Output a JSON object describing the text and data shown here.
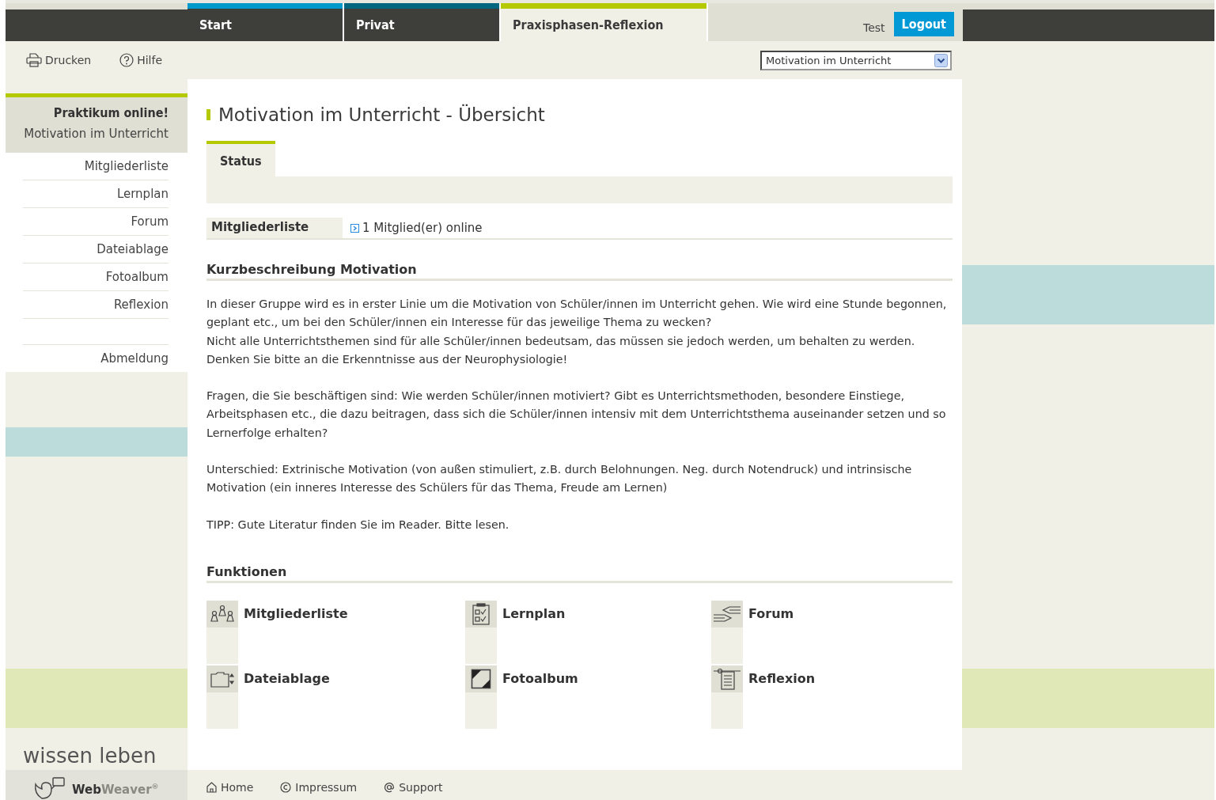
{
  "header": {
    "tabs": [
      {
        "label": "Start",
        "selected": false,
        "color": "#0099cc"
      },
      {
        "label": "Privat",
        "selected": false,
        "color": "#006680"
      },
      {
        "label": "Praxisphasen-Reflexion",
        "selected": true,
        "color": "#b5c900"
      }
    ],
    "user": "Test",
    "logout": "Logout"
  },
  "toolbar": {
    "print": "Drucken",
    "help": "Hilfe",
    "group_select": "Motivation im Unterricht"
  },
  "sidebar": {
    "title": "Praktikum online!",
    "subtitle": "Motivation im Unterricht",
    "items": [
      "Mitgliederliste",
      "Lernplan",
      "Forum",
      "Dateiablage",
      "Fotoalbum",
      "Reflexion"
    ],
    "logout": "Abmeldung",
    "slogan": "wissen leben"
  },
  "main": {
    "title": "Motivation im Unterricht - Übersicht",
    "tabs": [
      {
        "label": "Status",
        "selected": true
      }
    ],
    "members": {
      "label": "Mitgliederliste",
      "value": "1 Mitglied(er) online"
    },
    "description": {
      "heading": "Kurzbeschreibung Motivation",
      "blocks": [
        [
          "In dieser Gruppe wird es in erster Linie um die Motivation von Schüler/innen im Unterricht gehen. Wie wird eine Stunde begonnen, geplant etc., um bei den Schüler/innen ein Interesse für das jeweilige Thema zu wecken?",
          "Nicht alle Unterrichtsthemen sind für alle Schüler/innen bedeutsam, das müssen sie jedoch werden, um behalten zu werden.",
          "Denken Sie bitte an die Erkenntnisse aus der Neurophysiologie!"
        ],
        [
          "Fragen, die Sie beschäftigen sind: Wie werden Schüler/innen motiviert? Gibt es Unterrichtsmethoden, besondere Einstiege, Arbeitsphasen etc., die dazu beitragen, dass sich die Schüler/innen intensiv mit dem Unterrichtsthema auseinander setzen und so Lernerfolge erhalten?"
        ],
        [
          "Unterschied: Extrinische Motivation (von außen stimuliert, z.B. durch Belohnungen. Neg. durch Notendruck) und intrinsische Motivation (ein inneres Interesse des Schülers für das Thema, Freude am Lernen)"
        ],
        [
          "TIPP: Gute Literatur finden Sie im Reader. Bitte lesen."
        ]
      ]
    },
    "functions": {
      "heading": "Funktionen",
      "items": [
        {
          "label": "Mitgliederliste",
          "kind": "members"
        },
        {
          "label": "Lernplan",
          "kind": "plan"
        },
        {
          "label": "Forum",
          "kind": "forum"
        },
        {
          "label": "Dateiablage",
          "kind": "files"
        },
        {
          "label": "Fotoalbum",
          "kind": "photos"
        },
        {
          "label": "Reflexion",
          "kind": "reflection"
        }
      ]
    }
  },
  "footer": {
    "logo": {
      "part_1": "Web",
      "part_2": "Weaver",
      "mark": "®"
    },
    "links": [
      {
        "label": "Home",
        "kind": "home"
      },
      {
        "label": "Impressum",
        "kind": "copyright"
      },
      {
        "label": "Support",
        "kind": "at"
      }
    ]
  }
}
